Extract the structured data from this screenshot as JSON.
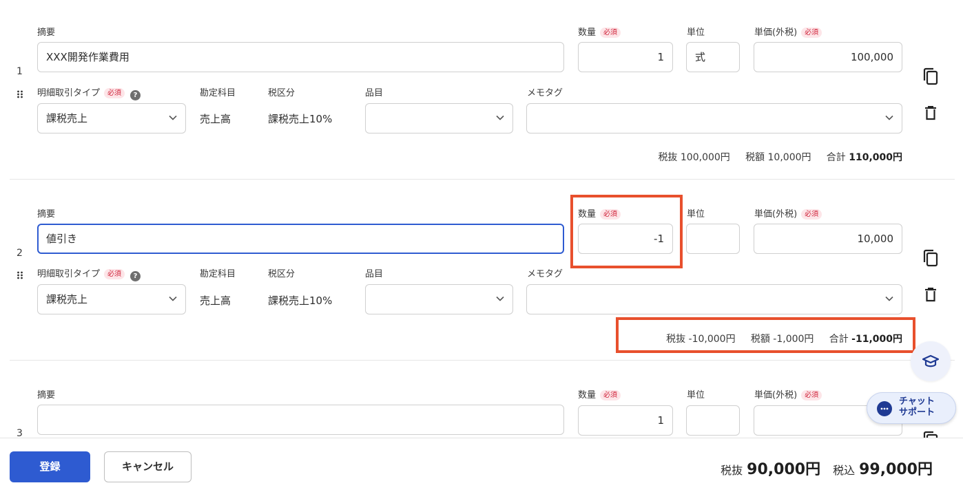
{
  "labels": {
    "summary": "摘要",
    "quantity": "数量",
    "unit": "単位",
    "unit_price": "単価(外税)",
    "required": "必須",
    "line_type": "明細取引タイプ",
    "help": "?",
    "account": "勘定科目",
    "tax_class": "税区分",
    "item": "品目",
    "memo_tag": "メモタグ",
    "tax_excl": "税抜",
    "tax": "税額",
    "total": "合計"
  },
  "rows": [
    {
      "num": "1",
      "summary": "XXX開発作業費用",
      "quantity": "1",
      "unit": "式",
      "unit_price": "100,000",
      "line_type": "課税売上",
      "account": "売上高",
      "tax_class": "課税売上10%",
      "item": "",
      "memo_tag": "",
      "sub_excl": "100,000円",
      "sub_tax": "10,000円",
      "sub_total": "110,000円"
    },
    {
      "num": "2",
      "summary": "値引き",
      "quantity": "-1",
      "unit": "",
      "unit_price": "10,000",
      "line_type": "課税売上",
      "account": "売上高",
      "tax_class": "課税売上10%",
      "item": "",
      "memo_tag": "",
      "sub_excl": "-10,000円",
      "sub_tax": "-1,000円",
      "sub_total": "-11,000円"
    },
    {
      "num": "3",
      "summary": "",
      "quantity": "1",
      "unit": "",
      "unit_price": ""
    }
  ],
  "footer": {
    "register": "登録",
    "cancel": "キャンセル",
    "tax_excl_label": "税抜",
    "tax_excl_value": "90,000円",
    "tax_incl_label": "税込",
    "tax_incl_value": "99,000円"
  },
  "chat": {
    "line1": "チャット",
    "line2": "サポート"
  },
  "colors": {
    "accent": "#2e5bd1",
    "required_bg": "#fde5e8",
    "required_text": "#d0233a",
    "highlight": "#e8502d"
  },
  "icons": [
    "drag-handle-icon",
    "copy-icon",
    "trash-icon",
    "chevron-down-icon",
    "help-icon",
    "graduation-cap-icon",
    "chat-bubble-icon"
  ]
}
